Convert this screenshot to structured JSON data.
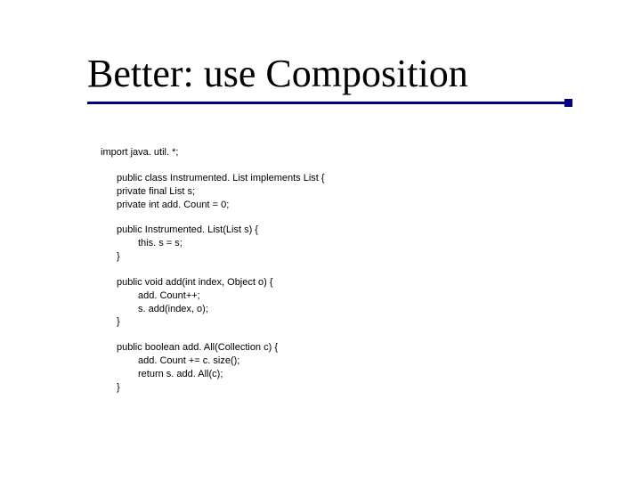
{
  "title": "Better: use Composition",
  "code": {
    "l01": "import java. util. *;",
    "l02": "public class Instrumented. List implements List {",
    "l03": "private final List s;",
    "l04": "private int add. Count = 0;",
    "l05": "public Instrumented. List(List s) {",
    "l06": "this. s = s;",
    "l07": "}",
    "l08": "public void add(int index, Object o) {",
    "l09": "add. Count++;",
    "l10": "s. add(index, o);",
    "l11": "}",
    "l12": "public boolean add. All(Collection c) {",
    "l13": "add. Count += c. size();",
    "l14": "return s. add. All(c);",
    "l15": "}"
  }
}
